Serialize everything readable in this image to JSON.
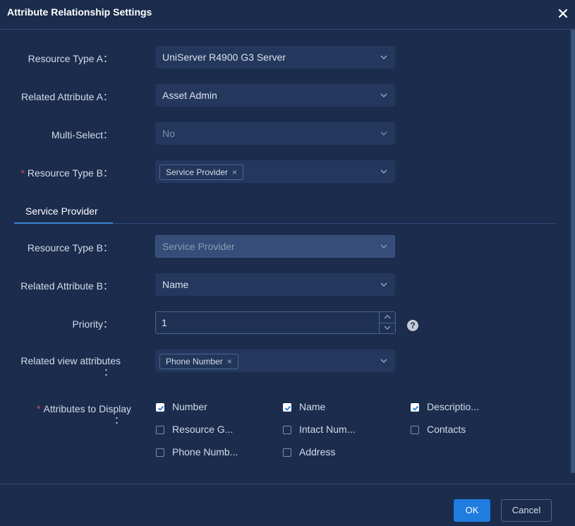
{
  "dialog": {
    "title": "Attribute Relationship Settings",
    "close_icon": "close-icon"
  },
  "form": {
    "resource_type_a": {
      "label": "Resource Type A：",
      "value": "UniServer R4900 G3 Server"
    },
    "related_attribute_a": {
      "label": "Related Attribute A：",
      "value": "Asset Admin"
    },
    "multi_select": {
      "label": "Multi-Select：",
      "value": "No"
    },
    "resource_type_b": {
      "required_mark": "*",
      "label": "Resource Type B：",
      "tag": "Service Provider",
      "tag_remove": "×"
    }
  },
  "tabs": [
    {
      "label": "Service Provider"
    }
  ],
  "tab_form": {
    "resource_type_b": {
      "label": "Resource Type B：",
      "value": "Service Provider"
    },
    "related_attribute_b": {
      "label": "Related Attribute B：",
      "value": "Name"
    },
    "priority": {
      "label": "Priority：",
      "value": "1",
      "help": "?"
    },
    "related_view_attributes": {
      "label_line1": "Related view attributes",
      "label_line2": "：",
      "tag": "Phone Number",
      "tag_remove": "×"
    },
    "attributes_to_display": {
      "required_mark": "*",
      "label_line1": "Attributes to Display",
      "label_line2": "：",
      "options": [
        {
          "label": "Number",
          "checked": true
        },
        {
          "label": "Name",
          "checked": true
        },
        {
          "label": "Descriptio...",
          "checked": true
        },
        {
          "label": "Resource G...",
          "checked": false
        },
        {
          "label": "Intact Num...",
          "checked": false
        },
        {
          "label": "Contacts",
          "checked": false
        },
        {
          "label": "Phone Numb...",
          "checked": false
        },
        {
          "label": "Address",
          "checked": false
        }
      ]
    }
  },
  "footer": {
    "ok_label": "OK",
    "cancel_label": "Cancel"
  },
  "colors": {
    "background": "#1b2c4c",
    "accent": "#1f7ce0",
    "required": "#e0475b"
  }
}
